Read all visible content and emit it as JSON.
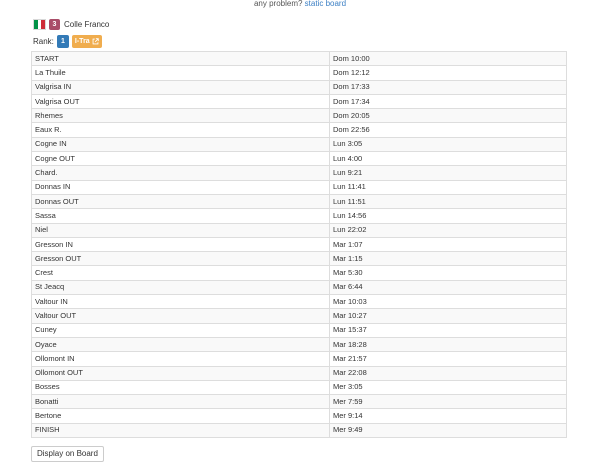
{
  "header": {
    "problem_text": "any problem?",
    "static_board_link": "static board"
  },
  "athlete": {
    "flag_icon": "italy-flag-icon",
    "flag_colors": [
      "#009246",
      "#ffffff",
      "#ce2b37"
    ],
    "bib": "3",
    "bib_color": "#a94d68",
    "name": "Colle Franco"
  },
  "rank": {
    "label": "Rank:",
    "position": "1",
    "position_color": "#337ab7",
    "category": "I-Tra",
    "category_color": "#f0ad4e",
    "category_icon": "external-link-icon"
  },
  "splits": [
    {
      "point": "START",
      "time": "Dom 10:00"
    },
    {
      "point": "La Thuile",
      "time": "Dom 12:12"
    },
    {
      "point": "Valgrisa IN",
      "time": "Dom 17:33"
    },
    {
      "point": "Valgrisa OUT",
      "time": "Dom 17:34"
    },
    {
      "point": "Rhemes",
      "time": "Dom 20:05"
    },
    {
      "point": "Eaux R.",
      "time": "Dom 22:56"
    },
    {
      "point": "Cogne IN",
      "time": "Lun 3:05"
    },
    {
      "point": "Cogne OUT",
      "time": "Lun 4:00"
    },
    {
      "point": "Chard.",
      "time": "Lun 9:21"
    },
    {
      "point": "Donnas IN",
      "time": "Lun 11:41"
    },
    {
      "point": "Donnas OUT",
      "time": "Lun 11:51"
    },
    {
      "point": "Sassa",
      "time": "Lun 14:56"
    },
    {
      "point": "Niel",
      "time": "Lun 22:02"
    },
    {
      "point": "Gresson IN",
      "time": "Mar 1:07"
    },
    {
      "point": "Gresson OUT",
      "time": "Mar 1:15"
    },
    {
      "point": "Crest",
      "time": "Mar 5:30"
    },
    {
      "point": "St Jeacq",
      "time": "Mar 6:44"
    },
    {
      "point": "Valtour IN",
      "time": "Mar 10:03"
    },
    {
      "point": "Valtour OUT",
      "time": "Mar 10:27"
    },
    {
      "point": "Cuney",
      "time": "Mar 15:37"
    },
    {
      "point": "Oyace",
      "time": "Mar 18:28"
    },
    {
      "point": "Ollomont IN",
      "time": "Mar 21:57"
    },
    {
      "point": "Ollomont OUT",
      "time": "Mar 22:08"
    },
    {
      "point": "Bosses",
      "time": "Mer 3:05"
    },
    {
      "point": "Bonatti",
      "time": "Mer 7:59"
    },
    {
      "point": "Bertone",
      "time": "Mer 9:14"
    },
    {
      "point": "FINISH",
      "time": "Mer 9:49"
    }
  ],
  "actions": {
    "display_on_board_label": "Display on Board"
  }
}
